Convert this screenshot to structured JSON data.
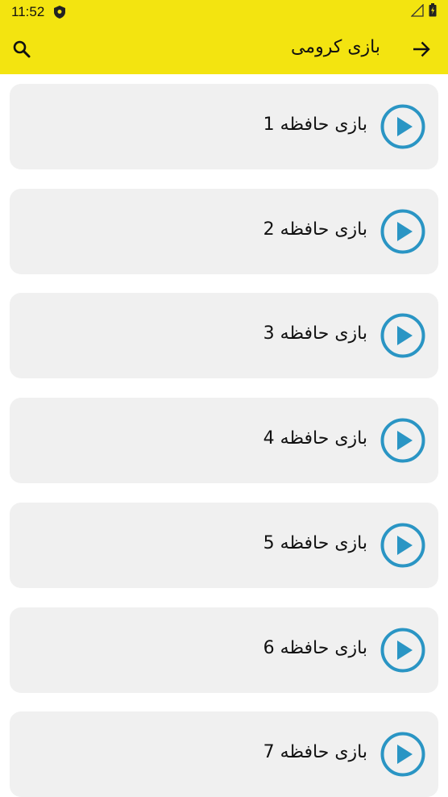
{
  "status": {
    "time": "11:52",
    "shield_icon": "shield-icon",
    "signal_icon": "signal-icon",
    "battery_icon": "battery-icon"
  },
  "toolbar": {
    "title": "بازی کرومی",
    "search_icon": "search-icon",
    "back_icon": "arrow-forward-icon"
  },
  "colors": {
    "bar": "#f3e410",
    "card": "#f0f0f0",
    "play": "#2a95c4"
  },
  "games": [
    {
      "label": "بازی حافظه 1"
    },
    {
      "label": "بازی حافظه 2"
    },
    {
      "label": "بازی حافظه 3"
    },
    {
      "label": "بازی حافظه 4"
    },
    {
      "label": "بازی حافظه 5"
    },
    {
      "label": "بازی حافظه 6"
    },
    {
      "label": "بازی حافظه 7"
    }
  ]
}
